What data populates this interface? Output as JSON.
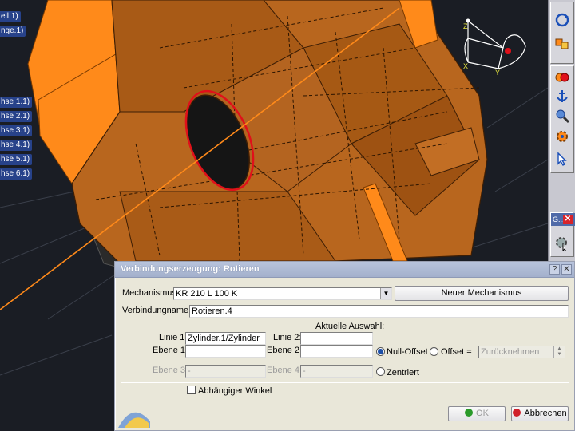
{
  "tree": {
    "items": [
      {
        "label": "ell.1)"
      },
      {
        "label": "nge.1)"
      },
      {
        "label": "hse 1.1)"
      },
      {
        "label": "hse 2.1)"
      },
      {
        "label": "hse 3.1)"
      },
      {
        "label": "hse 4.1)"
      },
      {
        "label": "hse 5.1)"
      },
      {
        "label": "hse 6.1)"
      }
    ]
  },
  "compass": {
    "axis_x": "X",
    "axis_y": "Y",
    "axis_z": "Z"
  },
  "toolbar": {
    "group_title": "G...",
    "group_close": "✕"
  },
  "dialog": {
    "title": "Verbindungserzeugung: Rotieren",
    "help_glyph": "?",
    "close_glyph": "✕",
    "mechanism_label": "Mechanismus:",
    "mechanism_value": "KR 210 L 100 K",
    "new_mechanism_button": "Neuer Mechanismus",
    "joint_name_label": "Verbindungname:",
    "joint_name_value": "Rotieren.4",
    "current_selection_label": "Aktuelle Auswahl:",
    "line1_label": "Linie 1:",
    "line1_value": "Zylinder.1/Zylinder",
    "line2_label": "Linie 2:",
    "line2_value": "",
    "plane1_label": "Ebene 1:",
    "plane1_value": "",
    "plane2_label": "Ebene 2:",
    "plane2_value": "",
    "plane3_label": "Ebene 3:",
    "plane3_value": "-",
    "plane4_label": "Ebene 4:",
    "plane4_value": "-",
    "null_offset_label": "Null-Offset",
    "offset_label": "Offset =",
    "offset_value": "Zurücknehmen",
    "centered_label": "Zentriert",
    "dependent_angle_label": "Abhängiger Winkel",
    "ok_button": "OK",
    "cancel_button": "Abbrechen",
    "colors": {
      "title_bar": "#a9b5d0",
      "ok_dot": "#2a9a2a",
      "cancel_dot": "#d0202a",
      "radio_selected": "#1c4fa8"
    }
  },
  "colors": {
    "part_orange": "#b8661e",
    "bright_orange": "#ff8a1a",
    "selection_red": "#e0101a",
    "tree_bg": "#27428a"
  }
}
